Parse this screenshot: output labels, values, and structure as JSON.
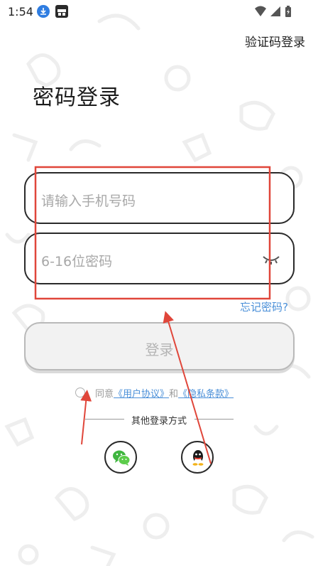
{
  "status_bar": {
    "time": "1:54",
    "icons": [
      "download-notification-icon",
      "app-notification-icon",
      "wifi-icon",
      "signal-icon",
      "battery-icon"
    ]
  },
  "header": {
    "switch_mode_label": "验证码登录"
  },
  "main": {
    "title": "密码登录",
    "phone_input": {
      "placeholder": "请输入手机号码",
      "value": ""
    },
    "password_input": {
      "placeholder": "6-16位密码",
      "value": ""
    },
    "forgot_password_label": "忘记密码?",
    "login_button_label": "登录"
  },
  "agreement": {
    "prefix": "同意",
    "user_agreement": "《用户协议》",
    "conjunction": "和",
    "privacy_policy": "《隐私条款》",
    "checked": false
  },
  "other_login": {
    "label": "其他登录方式",
    "options": [
      "wechat",
      "qq"
    ]
  },
  "colors": {
    "accent_link": "#4a8fd8",
    "annotation_red": "#e0463a",
    "border_dark": "#2a2a2a",
    "placeholder": "#a8a8a8"
  }
}
